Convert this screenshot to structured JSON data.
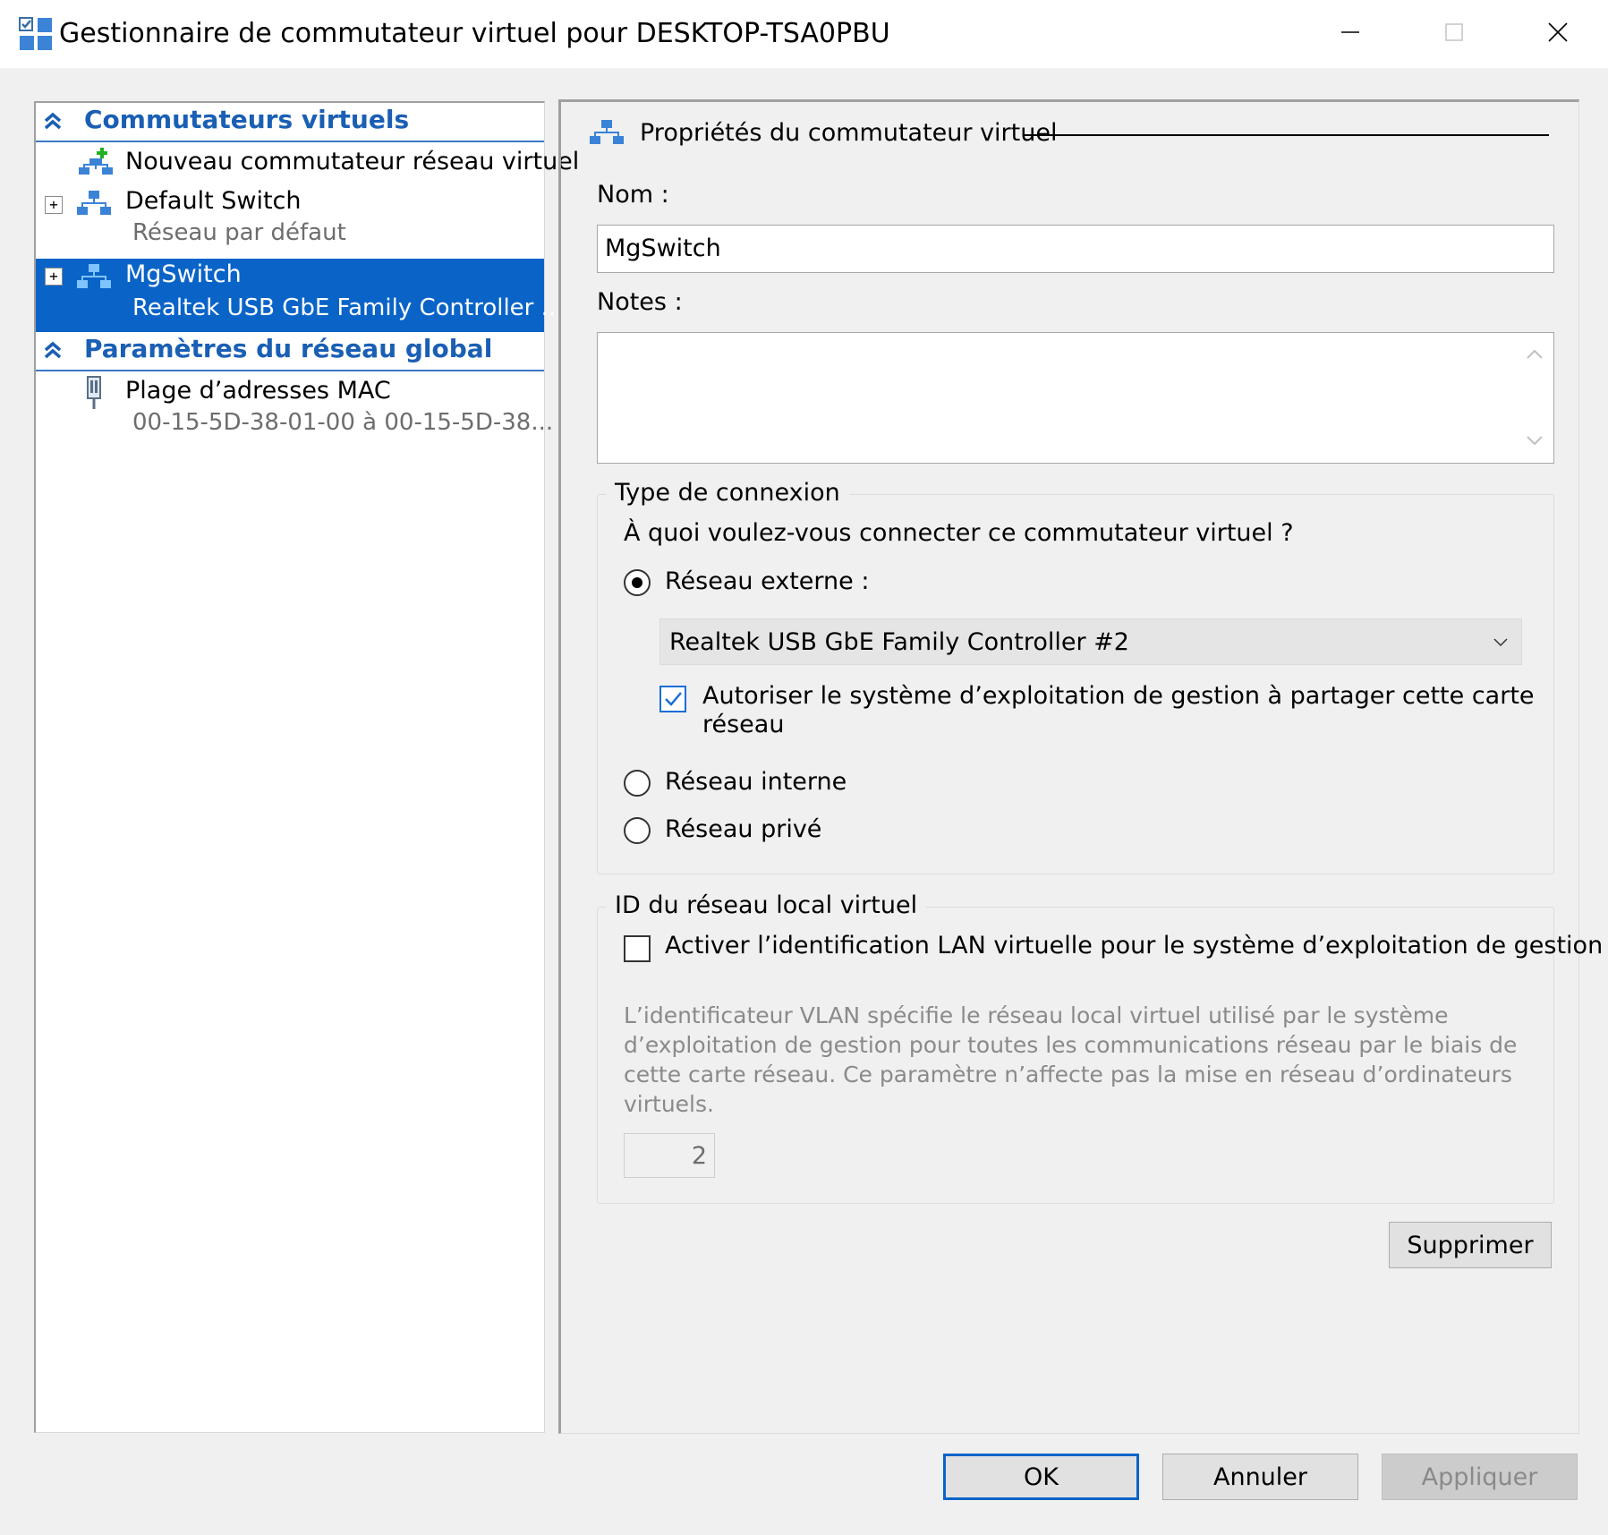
{
  "window": {
    "title": "Gestionnaire de commutateur virtuel pour DESKTOP-TSA0PBU",
    "minimize": "—",
    "maximize": "□",
    "close": "✕"
  },
  "sidebar": {
    "section_switches": "Commutateurs virtuels",
    "new_switch": "Nouveau commutateur réseau virtuel",
    "items": [
      {
        "label": "Default Switch",
        "sub": "Réseau par défaut"
      },
      {
        "label": "MgSwitch",
        "sub": "Realtek USB GbE Family Controller ..."
      }
    ],
    "section_global": "Paramètres du réseau global",
    "mac_label": "Plage d’adresses MAC",
    "mac_sub": "00-15-5D-38-01-00 à 00-15-5D-38..."
  },
  "properties": {
    "header": "Propriétés du commutateur virtuel",
    "name_label": "Nom :",
    "name_value": "MgSwitch",
    "notes_label": "Notes :",
    "notes_value": "",
    "connection_group": "Type de connexion",
    "connection_question": "À quoi voulez-vous connecter ce commutateur virtuel ?",
    "radio_external": "Réseau externe :",
    "adapter_selected": "Realtek USB GbE Family Controller #2",
    "share_check_label_1": "Autoriser le système d’exploitation de gestion à partager cette carte",
    "share_check_label_2": "réseau",
    "radio_internal": "Réseau interne",
    "radio_private": "Réseau privé",
    "vlan_group": "ID du réseau local virtuel",
    "vlan_check_label": "Activer l’identification LAN virtuelle pour le système d’exploitation de gestion",
    "vlan_desc_1": "L’identificateur VLAN spécifie le réseau local virtuel utilisé par le système",
    "vlan_desc_2": "d’exploitation de gestion pour toutes les communications réseau par le biais de",
    "vlan_desc_3": "cette carte réseau. Ce paramètre n’affecte pas la mise en réseau d’ordinateurs",
    "vlan_desc_4": "virtuels.",
    "vlan_id": "2",
    "delete_button": "Supprimer"
  },
  "footer": {
    "ok": "OK",
    "cancel": "Annuler",
    "apply": "Appliquer"
  },
  "state": {
    "selected_connection": "Réseau externe",
    "share_checked": true,
    "vlan_checked": false
  },
  "colors": {
    "selection": "#0a64c8",
    "section_title": "#1a5fb4",
    "disabled_text": "#8a8a8a"
  }
}
